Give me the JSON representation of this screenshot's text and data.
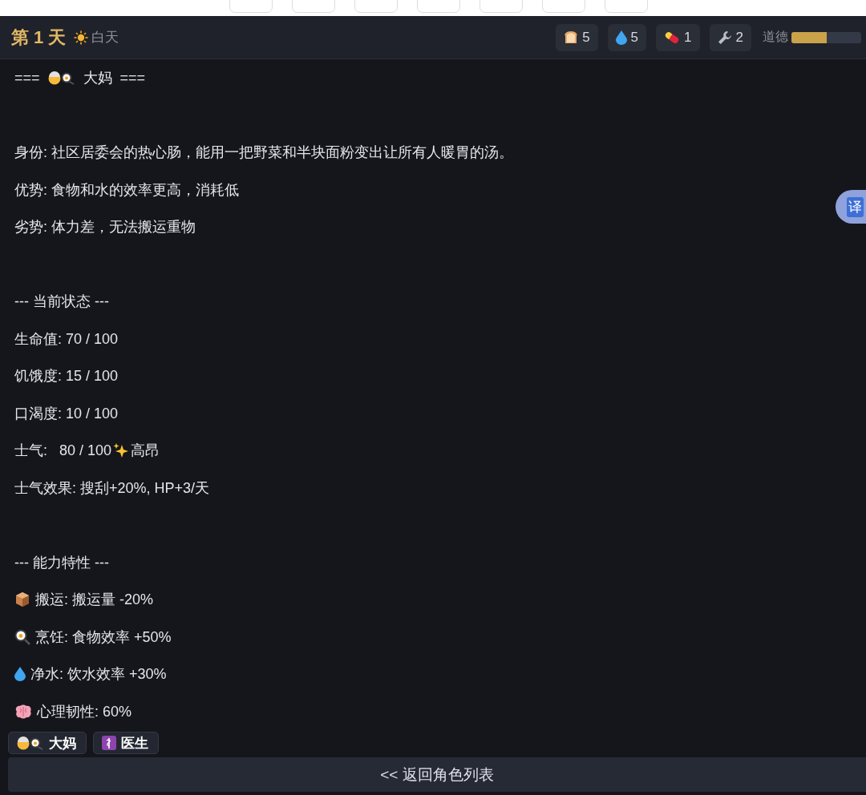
{
  "top_toolbar": [
    {
      "kind": "tool"
    },
    {
      "kind": "tool"
    },
    {
      "kind": "tool"
    },
    {
      "kind": "tool"
    },
    {
      "kind": "tool"
    },
    {
      "kind": "tool"
    },
    {
      "kind": "tool"
    }
  ],
  "header": {
    "day": "第 1 天",
    "period": {
      "kind": "day",
      "label": "白天"
    },
    "resources": [
      {
        "kind": "bread",
        "count": "5"
      },
      {
        "kind": "drop",
        "count": "5"
      },
      {
        "kind": "pill",
        "count": "1"
      },
      {
        "kind": "wrench",
        "count": "2"
      }
    ],
    "morality": {
      "label": "道德",
      "level": 0.5
    }
  },
  "profile": {
    "title": {
      "left": "===",
      "name": "大妈",
      "right": "==="
    },
    "identity": [
      "身份: 社区居委会的热心肠，能用一把野菜和半块面粉变出让所有人暖胃的汤。",
      "优势: 食物和水的效率更高，消耗低",
      "劣势: 体力差，无法搬运重物"
    ],
    "status": {
      "heading": "--- 当前状态 ---",
      "lines": [
        {
          "text": "生命值: 70 / 100"
        },
        {
          "text": "饥饿度: 15 / 100"
        },
        {
          "text": "口渴度: 10 / 100"
        },
        {
          "text": "士气:   80 / 100",
          "kind": "sparkle",
          "tag": "高昂"
        },
        {
          "text": "士气效果: 搜刮+20%, HP+3/天"
        }
      ]
    },
    "abilities": {
      "heading": "--- 能力特性 ---",
      "lines": [
        {
          "kind": "box",
          "text": "搬运: 搬运量 -20%"
        },
        {
          "kind": "egg",
          "text": "烹饪: 食物效率 +50%"
        },
        {
          "kind": "drop",
          "text": "净水: 饮水效率 +30%"
        },
        {
          "kind": "brain",
          "text": "心理韧性: 60%"
        }
      ]
    }
  },
  "character_tabs": [
    {
      "kind": "cook",
      "name": "大妈"
    },
    {
      "kind": "medical",
      "name": "医生"
    }
  ],
  "back_button": "<< 返回角色列表",
  "translate_button": "译"
}
